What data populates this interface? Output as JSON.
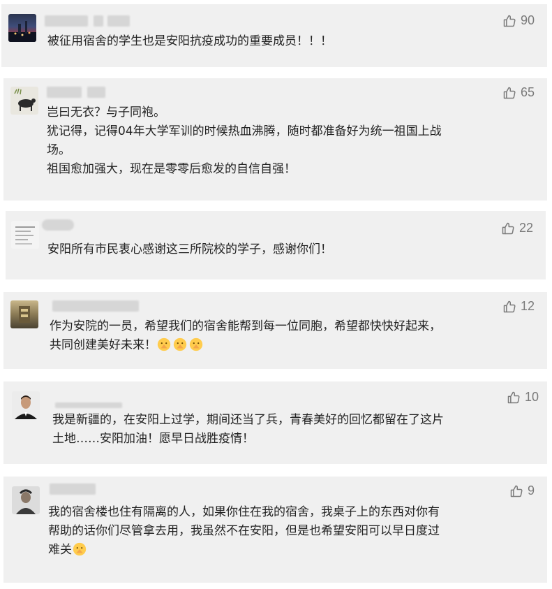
{
  "comments": [
    {
      "likes": "90",
      "lines": [
        "被征用宿舍的学生也是安阳抗疫成功的重要成员！！！"
      ]
    },
    {
      "likes": "65",
      "lines": [
        "岂曰无衣？与子同袍。",
        "犹记得，记得04年大学军训的时候热血沸腾，随时都准备好为统一祖国上战",
        "场。",
        "祖国愈加强大，现在是零零后愈发的自信自强！"
      ]
    },
    {
      "likes": "22",
      "lines": [
        "安阳所有市民衷心感谢这三所院校的学子，感谢你们！"
      ]
    },
    {
      "likes": "12",
      "lines": [
        "作为安院的一员，希望我们的宿舍能帮到每一位同胞，希望都快快好起来，",
        "共同创建美好未来！"
      ]
    },
    {
      "likes": "10",
      "lines": [
        "我是新疆的，在安阳上过学，期间还当了兵，青春美好的回忆都留在了这片",
        "土地……安阳加油！愿早日战胜疫情！"
      ]
    },
    {
      "likes": "9",
      "lines": [
        "我的宿舍楼也住有隔离的人，如果你住在我的宿舍，我桌子上的东西对你有",
        "帮助的话你们尽管拿去用，我虽然不在安阳，但是也希望安阳可以早日度过",
        "难关"
      ]
    }
  ],
  "icons": {
    "like": "thumbs-up-icon",
    "emoji": "pray-hands-emoji"
  },
  "colors": {
    "card_bg": "#f0f0f0",
    "text": "#222222",
    "like": "#7a7a7a"
  }
}
